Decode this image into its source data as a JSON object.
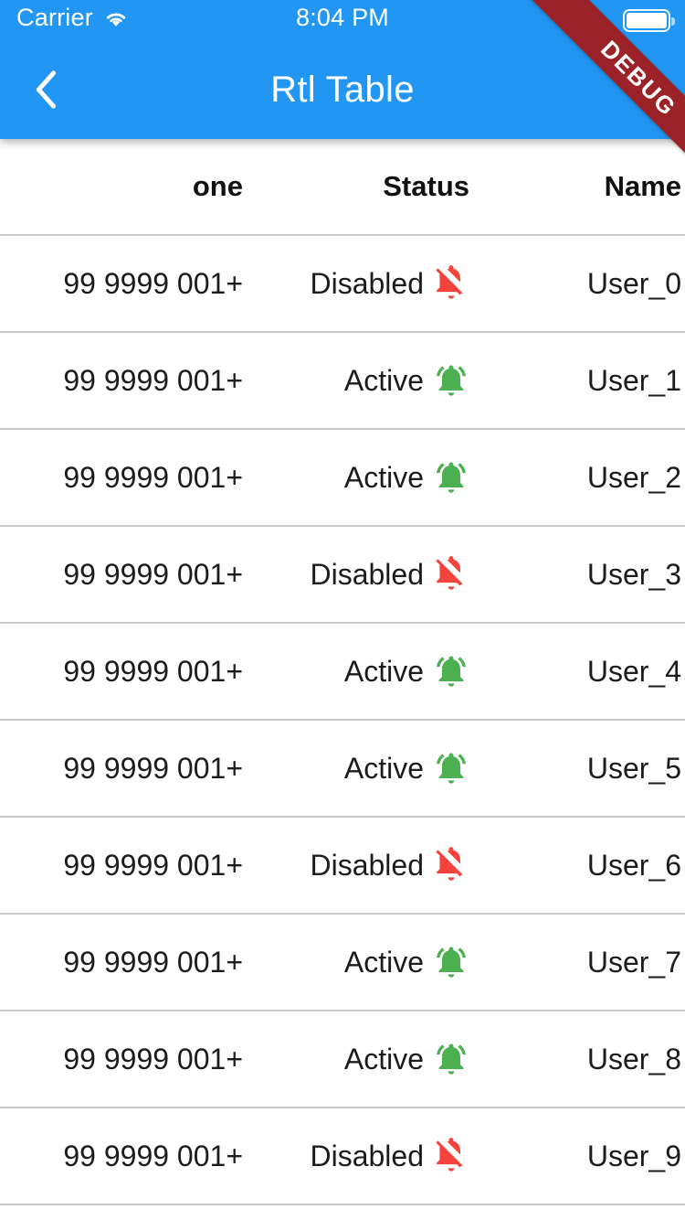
{
  "status_bar": {
    "carrier": "Carrier",
    "wifi_icon": "wifi-icon",
    "time": "8:04 PM",
    "battery_icon": "battery-full-icon"
  },
  "app_bar": {
    "title": "Rtl Table",
    "back_icon": "back-chevron-icon",
    "background_color": "#2196f3",
    "title_color": "#ffffff"
  },
  "debug_banner": {
    "label": "DEBUG",
    "color": "#9b2226",
    "text_color": "#ffffff"
  },
  "table": {
    "direction": "rtl",
    "columns": [
      {
        "key": "name",
        "label": "Name"
      },
      {
        "key": "status",
        "label": "Status"
      },
      {
        "key": "phone",
        "label": "one"
      }
    ],
    "active_label": "Active",
    "disabled_label": "Disabled",
    "active_color": "#4caf50",
    "disabled_color": "#f4433d",
    "active_icon": "notifications-active-icon",
    "disabled_icon": "notifications-off-icon",
    "rows": [
      {
        "name": "User_0",
        "status": "Disabled",
        "phone": "99 9999 001+"
      },
      {
        "name": "User_1",
        "status": "Active",
        "phone": "99 9999 001+"
      },
      {
        "name": "User_2",
        "status": "Active",
        "phone": "99 9999 001+"
      },
      {
        "name": "User_3",
        "status": "Disabled",
        "phone": "99 9999 001+"
      },
      {
        "name": "User_4",
        "status": "Active",
        "phone": "99 9999 001+"
      },
      {
        "name": "User_5",
        "status": "Active",
        "phone": "99 9999 001+"
      },
      {
        "name": "User_6",
        "status": "Disabled",
        "phone": "99 9999 001+"
      },
      {
        "name": "User_7",
        "status": "Active",
        "phone": "99 9999 001+"
      },
      {
        "name": "User_8",
        "status": "Active",
        "phone": "99 9999 001+"
      },
      {
        "name": "User_9",
        "status": "Disabled",
        "phone": "99 9999 001+"
      }
    ]
  }
}
